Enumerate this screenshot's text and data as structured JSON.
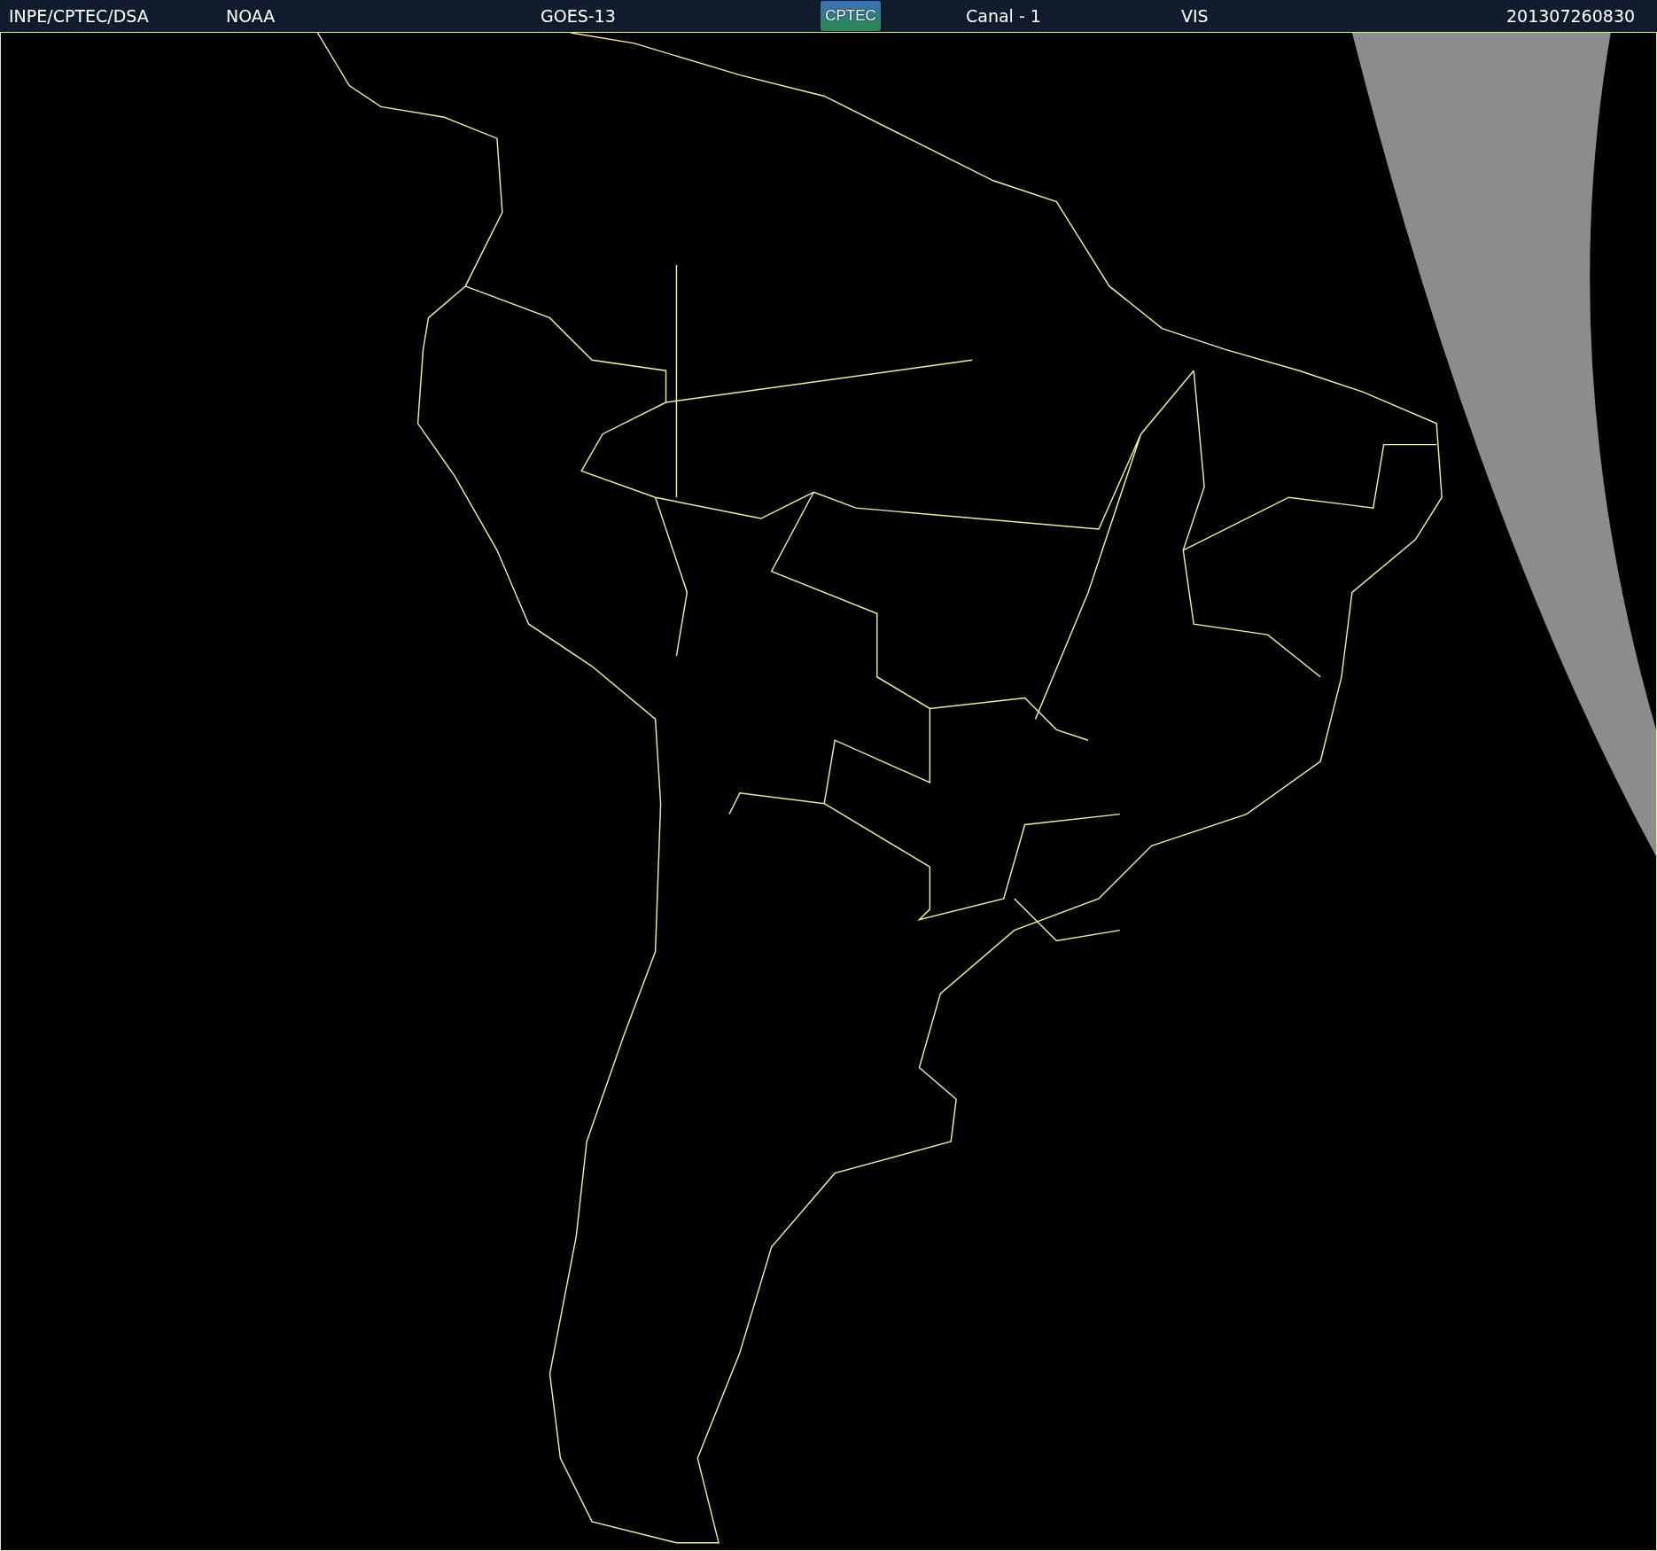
{
  "header": {
    "items": [
      {
        "kind": "text",
        "text": "INPE/CPTEC/DSA"
      },
      {
        "kind": "text",
        "text": "NOAA"
      },
      {
        "kind": "text",
        "text": "GOES-13"
      },
      {
        "kind": "logo",
        "text": "CPTEC"
      },
      {
        "kind": "text",
        "text": "Canal - 1"
      },
      {
        "kind": "text",
        "text": "VIS"
      },
      {
        "kind": "text",
        "text": "201307260830"
      }
    ]
  }
}
